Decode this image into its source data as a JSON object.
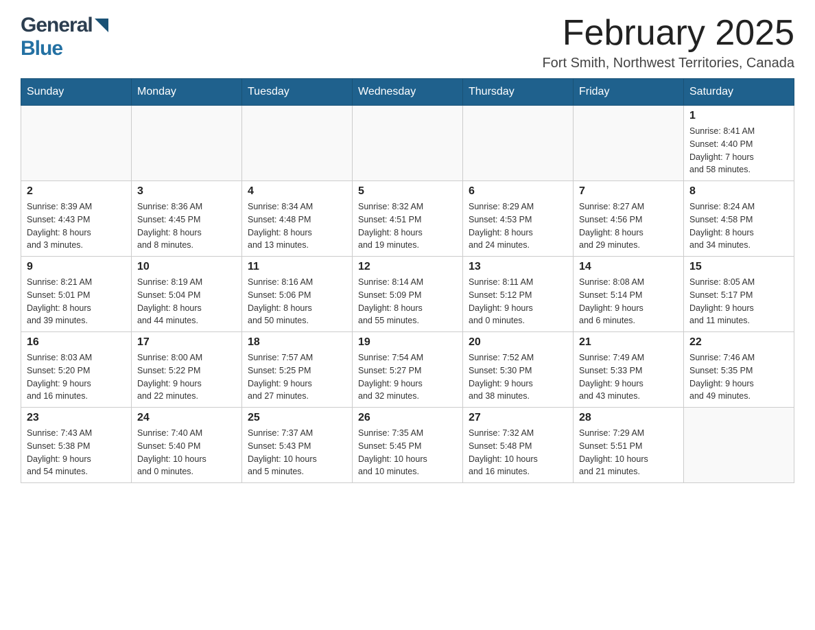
{
  "header": {
    "logo_general": "General",
    "logo_blue": "Blue",
    "month_title": "February 2025",
    "subtitle": "Fort Smith, Northwest Territories, Canada"
  },
  "calendar": {
    "days_of_week": [
      "Sunday",
      "Monday",
      "Tuesday",
      "Wednesday",
      "Thursday",
      "Friday",
      "Saturday"
    ],
    "weeks": [
      [
        {
          "day": "",
          "info": ""
        },
        {
          "day": "",
          "info": ""
        },
        {
          "day": "",
          "info": ""
        },
        {
          "day": "",
          "info": ""
        },
        {
          "day": "",
          "info": ""
        },
        {
          "day": "",
          "info": ""
        },
        {
          "day": "1",
          "info": "Sunrise: 8:41 AM\nSunset: 4:40 PM\nDaylight: 7 hours\nand 58 minutes."
        }
      ],
      [
        {
          "day": "2",
          "info": "Sunrise: 8:39 AM\nSunset: 4:43 PM\nDaylight: 8 hours\nand 3 minutes."
        },
        {
          "day": "3",
          "info": "Sunrise: 8:36 AM\nSunset: 4:45 PM\nDaylight: 8 hours\nand 8 minutes."
        },
        {
          "day": "4",
          "info": "Sunrise: 8:34 AM\nSunset: 4:48 PM\nDaylight: 8 hours\nand 13 minutes."
        },
        {
          "day": "5",
          "info": "Sunrise: 8:32 AM\nSunset: 4:51 PM\nDaylight: 8 hours\nand 19 minutes."
        },
        {
          "day": "6",
          "info": "Sunrise: 8:29 AM\nSunset: 4:53 PM\nDaylight: 8 hours\nand 24 minutes."
        },
        {
          "day": "7",
          "info": "Sunrise: 8:27 AM\nSunset: 4:56 PM\nDaylight: 8 hours\nand 29 minutes."
        },
        {
          "day": "8",
          "info": "Sunrise: 8:24 AM\nSunset: 4:58 PM\nDaylight: 8 hours\nand 34 minutes."
        }
      ],
      [
        {
          "day": "9",
          "info": "Sunrise: 8:21 AM\nSunset: 5:01 PM\nDaylight: 8 hours\nand 39 minutes."
        },
        {
          "day": "10",
          "info": "Sunrise: 8:19 AM\nSunset: 5:04 PM\nDaylight: 8 hours\nand 44 minutes."
        },
        {
          "day": "11",
          "info": "Sunrise: 8:16 AM\nSunset: 5:06 PM\nDaylight: 8 hours\nand 50 minutes."
        },
        {
          "day": "12",
          "info": "Sunrise: 8:14 AM\nSunset: 5:09 PM\nDaylight: 8 hours\nand 55 minutes."
        },
        {
          "day": "13",
          "info": "Sunrise: 8:11 AM\nSunset: 5:12 PM\nDaylight: 9 hours\nand 0 minutes."
        },
        {
          "day": "14",
          "info": "Sunrise: 8:08 AM\nSunset: 5:14 PM\nDaylight: 9 hours\nand 6 minutes."
        },
        {
          "day": "15",
          "info": "Sunrise: 8:05 AM\nSunset: 5:17 PM\nDaylight: 9 hours\nand 11 minutes."
        }
      ],
      [
        {
          "day": "16",
          "info": "Sunrise: 8:03 AM\nSunset: 5:20 PM\nDaylight: 9 hours\nand 16 minutes."
        },
        {
          "day": "17",
          "info": "Sunrise: 8:00 AM\nSunset: 5:22 PM\nDaylight: 9 hours\nand 22 minutes."
        },
        {
          "day": "18",
          "info": "Sunrise: 7:57 AM\nSunset: 5:25 PM\nDaylight: 9 hours\nand 27 minutes."
        },
        {
          "day": "19",
          "info": "Sunrise: 7:54 AM\nSunset: 5:27 PM\nDaylight: 9 hours\nand 32 minutes."
        },
        {
          "day": "20",
          "info": "Sunrise: 7:52 AM\nSunset: 5:30 PM\nDaylight: 9 hours\nand 38 minutes."
        },
        {
          "day": "21",
          "info": "Sunrise: 7:49 AM\nSunset: 5:33 PM\nDaylight: 9 hours\nand 43 minutes."
        },
        {
          "day": "22",
          "info": "Sunrise: 7:46 AM\nSunset: 5:35 PM\nDaylight: 9 hours\nand 49 minutes."
        }
      ],
      [
        {
          "day": "23",
          "info": "Sunrise: 7:43 AM\nSunset: 5:38 PM\nDaylight: 9 hours\nand 54 minutes."
        },
        {
          "day": "24",
          "info": "Sunrise: 7:40 AM\nSunset: 5:40 PM\nDaylight: 10 hours\nand 0 minutes."
        },
        {
          "day": "25",
          "info": "Sunrise: 7:37 AM\nSunset: 5:43 PM\nDaylight: 10 hours\nand 5 minutes."
        },
        {
          "day": "26",
          "info": "Sunrise: 7:35 AM\nSunset: 5:45 PM\nDaylight: 10 hours\nand 10 minutes."
        },
        {
          "day": "27",
          "info": "Sunrise: 7:32 AM\nSunset: 5:48 PM\nDaylight: 10 hours\nand 16 minutes."
        },
        {
          "day": "28",
          "info": "Sunrise: 7:29 AM\nSunset: 5:51 PM\nDaylight: 10 hours\nand 21 minutes."
        },
        {
          "day": "",
          "info": ""
        }
      ]
    ]
  }
}
